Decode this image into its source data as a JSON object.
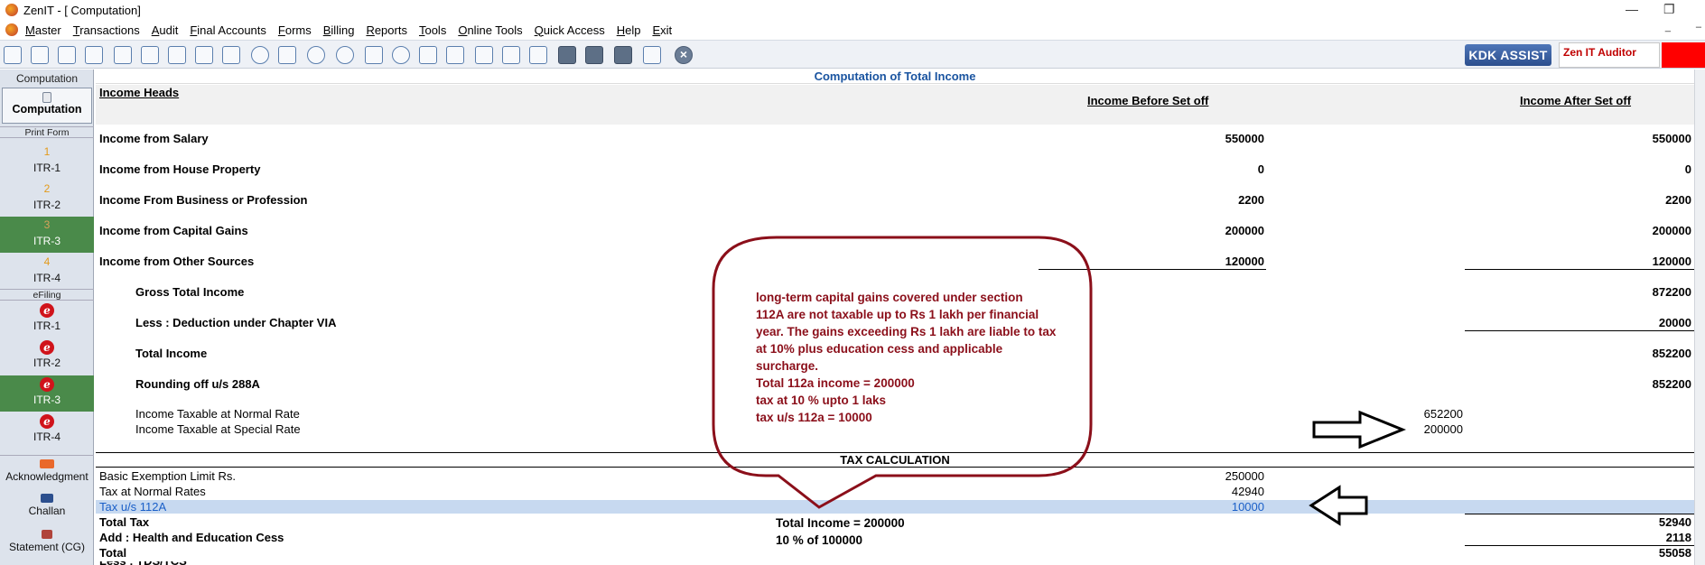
{
  "window": {
    "title": "ZenIT - [ Computation]"
  },
  "menu": [
    "Master",
    "Transactions",
    "Audit",
    "Final Accounts",
    "Forms",
    "Billing",
    "Reports",
    "Tools",
    "Online Tools",
    "Quick Access",
    "Help",
    "Exit"
  ],
  "toolbar": {
    "kdk_label": "KDK ASSIST",
    "auditor_label": "Zen IT Auditor"
  },
  "sidebar": {
    "section_computation": "Computation",
    "computation_button": "Computation",
    "print_form_label": "Print Form",
    "print_items": [
      {
        "num": "1",
        "label": "ITR-1"
      },
      {
        "num": "2",
        "label": "ITR-2"
      },
      {
        "num": "3",
        "label": "ITR-3"
      },
      {
        "num": "4",
        "label": "ITR-4"
      }
    ],
    "efiling_label": "eFiling",
    "efiling_items": [
      {
        "label": "ITR-1"
      },
      {
        "label": "ITR-2"
      },
      {
        "label": "ITR-3"
      },
      {
        "label": "ITR-4"
      }
    ],
    "e_glyph": "e",
    "acknowledgment": "Acknowledgment",
    "challan": "Challan",
    "statement": "Statement (CG)"
  },
  "computation": {
    "title": "Computation of Total Income",
    "col_heads": "Income Heads",
    "col_before": "Income Before Set off",
    "col_after": "Income After Set off",
    "rows": [
      {
        "label": "Income from Salary",
        "before": "550000",
        "after": "550000"
      },
      {
        "label": "Income from House Property",
        "before": "0",
        "after": "0"
      },
      {
        "label": "Income From Business or Profession",
        "before": "2200",
        "after": "2200"
      },
      {
        "label": "Income from Capital Gains",
        "before": "200000",
        "after": "200000"
      },
      {
        "label": "Income from Other Sources",
        "before": "120000",
        "after": "120000"
      }
    ],
    "gross_total_label": "Gross Total Income",
    "gross_total_value": "872200",
    "deduction_label": "Less : Deduction under Chapter VIA",
    "deduction_value": "20000",
    "total_income_label": "Total Income",
    "total_income_value": "852200",
    "rounding_label": "Rounding off u/s 288A",
    "rounding_value": "852200",
    "normal_rate_label": "Income Taxable at Normal Rate",
    "normal_rate_value": "652200",
    "special_rate_label": "Income Taxable at Special Rate",
    "special_rate_value": "200000"
  },
  "tax": {
    "heading": "TAX CALCULATION",
    "basic_exemption_label": "Basic Exemption Limit Rs.",
    "basic_exemption_value": "250000",
    "normal_rates_label": "Tax at Normal Rates",
    "normal_rates_value": "42940",
    "tax_112a_label": "Tax u/s 112A",
    "tax_112a_value": "10000",
    "total_tax_label": "Total Tax",
    "total_tax_value": "52940",
    "cess_label": "Add : Health and Education Cess",
    "cess_value": "2118",
    "total_label": "Total",
    "total_value": "55058",
    "partial_label": "Less : TDS/TCS"
  },
  "annotations": {
    "callout_lines": [
      "long-term capital gains covered under section",
      "112A are not taxable up to Rs 1 lakh per financial",
      "year. The gains exceeding Rs 1 lakh are liable to tax",
      "at 10% plus education cess and applicable",
      "surcharge.",
      "Total 112a income = 200000",
      "tax at 10 % upto 1 laks",
      "tax u/s 112a  = 10000"
    ],
    "note_line1": "Total Income = 200000",
    "note_line2": "10 % of  100000",
    "callout_color": "#8b0f1a"
  }
}
